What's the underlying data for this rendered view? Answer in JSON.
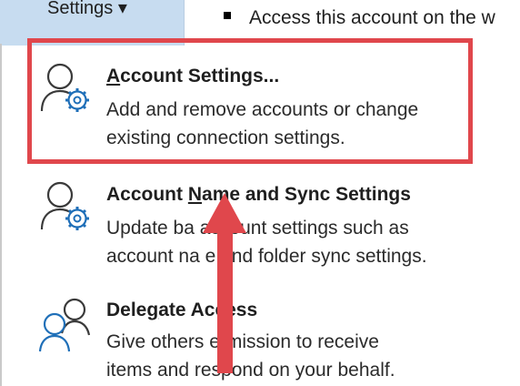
{
  "header": {
    "settings_tab_label": "Settings ▾",
    "info_text": "Access this account on the w"
  },
  "menu": {
    "items": [
      {
        "title": "Account Settings...",
        "title_accel_index": 0,
        "description_lines": [
          "Add and remove accounts or change",
          "existing connection settings."
        ],
        "icon": "person-gear-icon"
      },
      {
        "title": "Account Name and Sync Settings",
        "title_accel_index": 8,
        "description_lines": [
          "Update ba account settings such as",
          "account na e and folder sync settings."
        ],
        "icon": "person-gear-icon"
      },
      {
        "title": "Delegate Access",
        "description_lines": [
          "Give others ermission to receive",
          "items and respond on your behalf."
        ],
        "icon": "two-people-icon"
      }
    ]
  },
  "annotations": {
    "highlight_color": "#e0474c",
    "arrow_color": "#e0474c"
  }
}
